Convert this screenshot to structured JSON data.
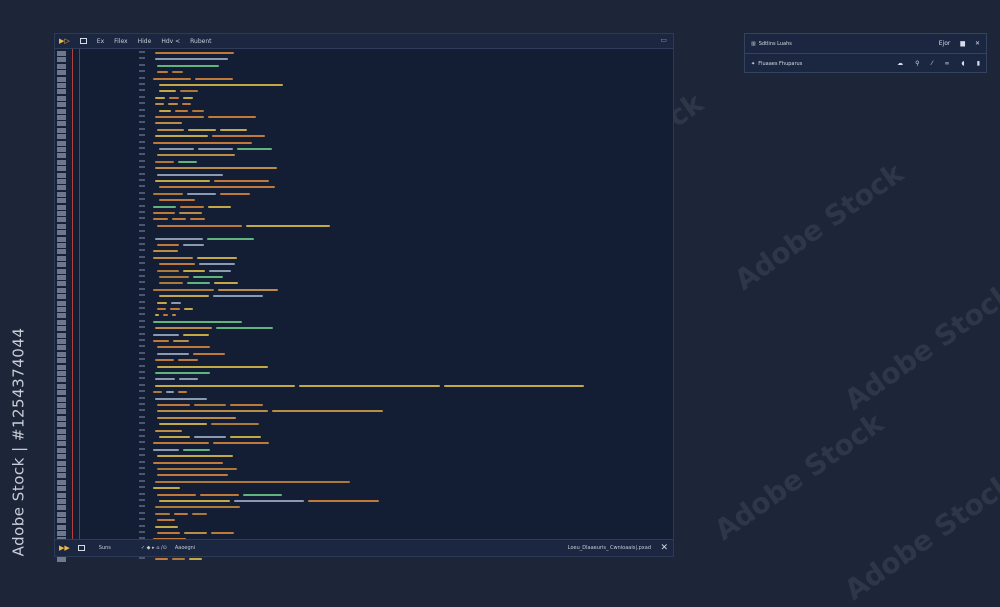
{
  "watermark": {
    "side_text": "Adobe Stock | #1254374044",
    "tiled_text": "Adobe Stock"
  },
  "editor": {
    "menu": {
      "run_icon": "play-icon",
      "items": [
        "Ex",
        "Filex",
        "Hide",
        "Hdv <",
        "Rubent"
      ]
    },
    "status": {
      "items": [
        "Suns",
        "Aaoegni"
      ],
      "right_text": "Loeu_Dlaaeuris_ Cwnioaais|.pxad"
    }
  },
  "panel": {
    "row1_title": "Sdtlins Luahs",
    "row1_right_label": "Ejor",
    "row2_title": "Fluaaes Fhuparus"
  },
  "colors": {
    "bg": "#1d2638",
    "editor_bg": "#131d33",
    "accent_orange": "#e08a3c",
    "accent_yellow": "#e2c24a",
    "accent_green": "#6fcf8a",
    "text_light": "#c6ccd8",
    "red_line": "#b4413b"
  }
}
